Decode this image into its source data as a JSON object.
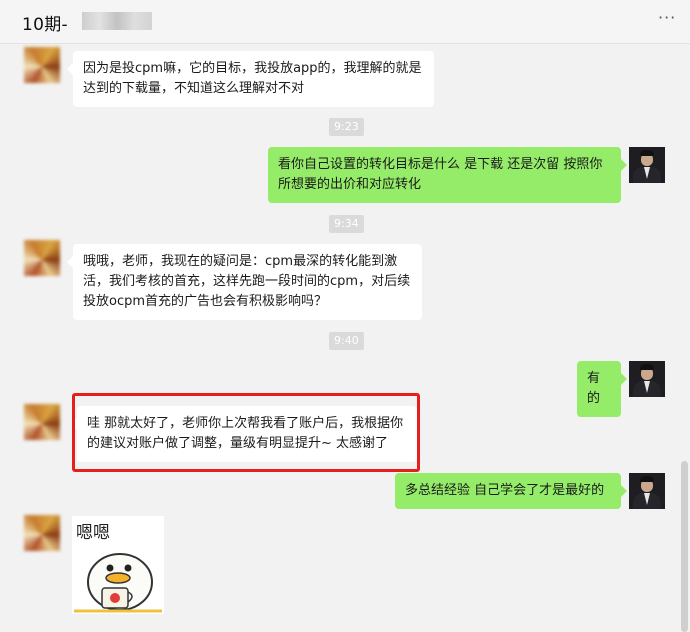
{
  "header": {
    "title": "10期-",
    "more_label": "···"
  },
  "messages": [
    {
      "id": "m1",
      "side": "left",
      "text": "因为是投cpm嘛，它的目标，我投放app的，我理解的就是达到的下载量，不知道这么理解对不对"
    },
    {
      "id": "t1",
      "type": "time",
      "text": "9:23"
    },
    {
      "id": "m2",
      "side": "right",
      "text": "看你自己设置的转化目标是什么  是下载 还是次留 按照你所想要的出价和对应转化"
    },
    {
      "id": "t2",
      "type": "time",
      "text": "9:34"
    },
    {
      "id": "m3",
      "side": "left",
      "text": "哦哦，老师，我现在的疑问是：cpm最深的转化能到激活，我们考核的首充，这样先跑一段时间的cpm，对后续投放ocpm首充的广告也会有积极影响吗？"
    },
    {
      "id": "t3",
      "type": "time",
      "text": "9:40"
    },
    {
      "id": "m4",
      "side": "right",
      "text": "有的"
    },
    {
      "id": "m5",
      "side": "left",
      "text": "哇 那就太好了，老师你上次帮我看了账户后，我根据你的建议对账户做了调整，量级有明显提升~  太感谢了"
    },
    {
      "id": "m6",
      "side": "right",
      "text": "多总结经验  自己学会了才是最好的"
    },
    {
      "id": "m7",
      "side": "left",
      "type": "sticker",
      "text": "嗯嗯"
    }
  ],
  "colors": {
    "self_bubble": "#95ec69",
    "other_bubble": "#ffffff",
    "highlight": "#e61e1e",
    "background": "#f2f2f2"
  },
  "icons": {
    "more": "more-dots-icon",
    "sticker": "duck-sticker-icon"
  }
}
